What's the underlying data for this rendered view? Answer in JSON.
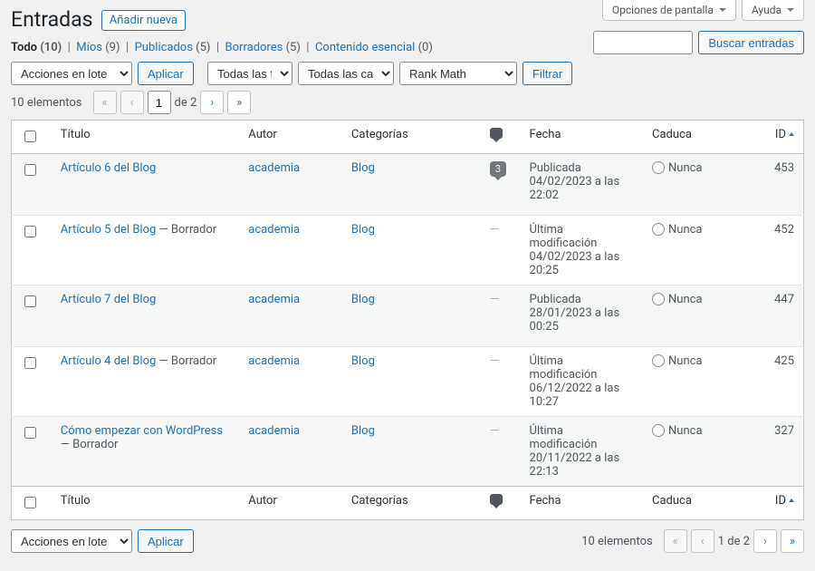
{
  "screen_options": {
    "label": "Opciones de pantalla"
  },
  "help": {
    "label": "Ayuda"
  },
  "page_title": "Entradas",
  "add_new_label": "Añadir nueva",
  "filters": {
    "all": {
      "label": "Todo",
      "count": "(10)"
    },
    "mine": {
      "label": "Míos",
      "count": "(9)"
    },
    "published": {
      "label": "Publicados",
      "count": "(5)"
    },
    "drafts": {
      "label": "Borradores",
      "count": "(5)"
    },
    "cornerstone": {
      "label": "Contenido esencial",
      "count": "(0)"
    }
  },
  "search": {
    "button": "Buscar entradas"
  },
  "bulk": {
    "placeholder": "Acciones en lote",
    "apply": "Aplicar"
  },
  "date_filter": "Todas las fechas",
  "cat_filter": "Todas las categorías",
  "rank_filter": "Rank Math",
  "filter_button": "Filtrar",
  "pagination": {
    "items": "10 elementos",
    "current": "1",
    "of_label": "de 2",
    "range": "1 de 2"
  },
  "columns": {
    "title": "Título",
    "author": "Autor",
    "categories": "Categorías",
    "date": "Fecha",
    "expire": "Caduca",
    "id": "ID"
  },
  "rows": [
    {
      "title": "Artículo 6 del Blog",
      "state": "",
      "author": "academia",
      "category": "Blog",
      "comments": "3",
      "date_status": "Publicada",
      "date_value": "04/02/2023 a las 22:02",
      "expire": "Nunca",
      "id": "453"
    },
    {
      "title": "Artículo 5 del Blog",
      "state": " — Borrador",
      "author": "academia",
      "category": "Blog",
      "comments": "",
      "date_status": "Última modificación",
      "date_value": "04/02/2023 a las 20:25",
      "expire": "Nunca",
      "id": "452"
    },
    {
      "title": "Artículo 7 del Blog",
      "state": "",
      "author": "academia",
      "category": "Blog",
      "comments": "",
      "date_status": "Publicada",
      "date_value": "28/01/2023 a las 00:25",
      "expire": "Nunca",
      "id": "447"
    },
    {
      "title": "Artículo 4 del Blog",
      "state": " — Borrador",
      "author": "academia",
      "category": "Blog",
      "comments": "",
      "date_status": "Última modificación",
      "date_value": "06/12/2022 a las 10:27",
      "expire": "Nunca",
      "id": "425"
    },
    {
      "title": "Cómo empezar con WordPress",
      "state": " — Borrador",
      "author": "academia",
      "category": "Blog",
      "comments": "",
      "date_status": "Última modificación",
      "date_value": "20/11/2022 a las 22:13",
      "expire": "Nunca",
      "id": "327"
    }
  ]
}
